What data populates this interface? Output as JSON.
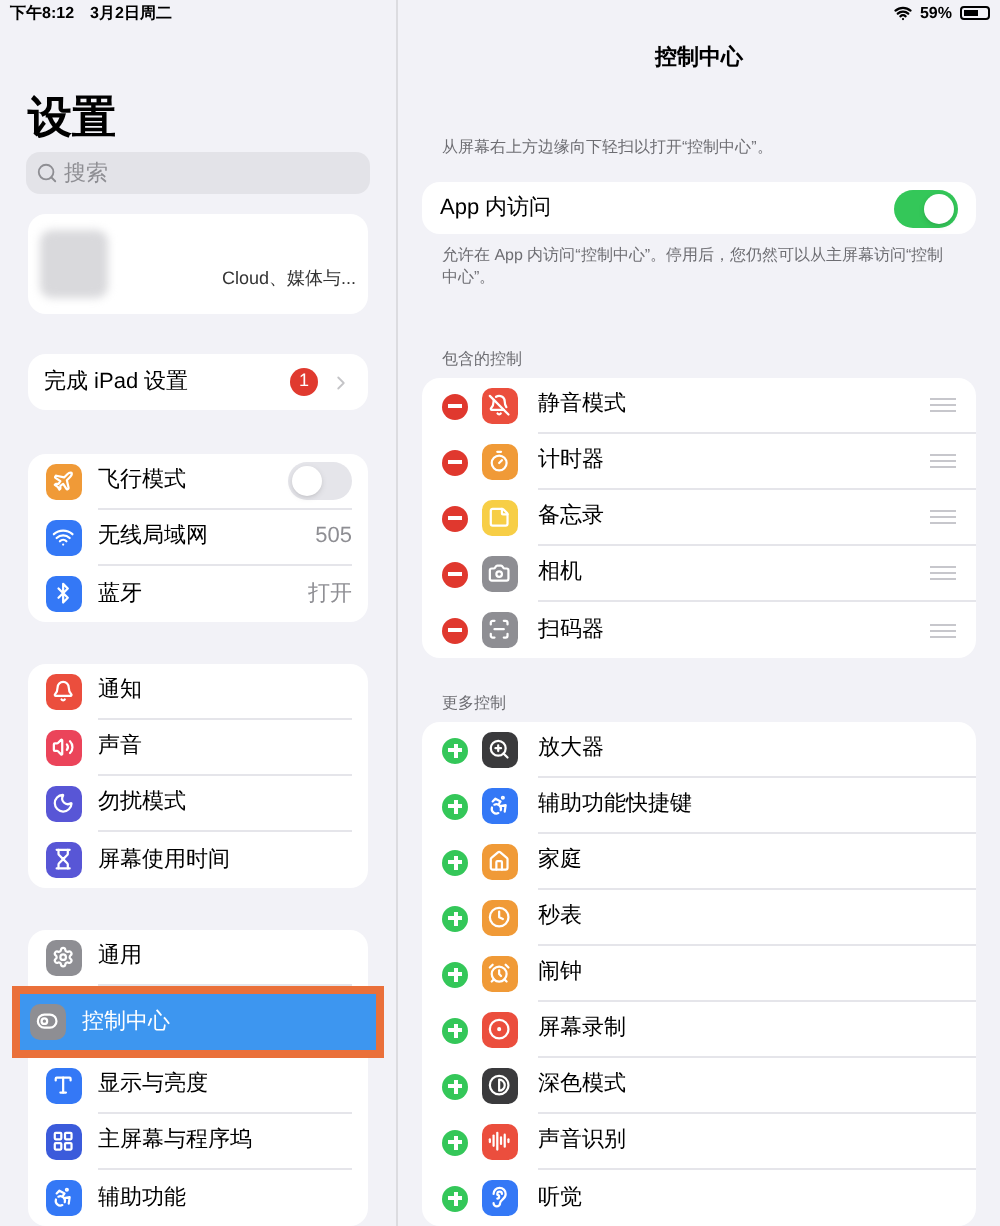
{
  "status_bar": {
    "time": "下午8:12",
    "date": "3月2日周二",
    "battery": "59%"
  },
  "sidebar": {
    "title": "设置",
    "search": {
      "placeholder": "搜索"
    },
    "profile": {
      "subtitle": "Cloud、媒体与..."
    },
    "setup": {
      "label": "完成 iPad 设置",
      "badge": "1"
    },
    "groups": [
      [
        {
          "label": "飞行模式",
          "kind": "toggle",
          "on": false,
          "selected": false
        },
        {
          "label": "无线局域网",
          "kind": "value",
          "value": "505",
          "selected": false
        },
        {
          "label": "蓝牙",
          "kind": "value",
          "value": "打开",
          "selected": false
        }
      ],
      [
        {
          "label": "通知",
          "kind": "plain",
          "selected": false
        },
        {
          "label": "声音",
          "kind": "plain",
          "selected": false
        },
        {
          "label": "勿扰模式",
          "kind": "plain",
          "selected": false
        },
        {
          "label": "屏幕使用时间",
          "kind": "plain",
          "selected": false
        }
      ],
      [
        {
          "label": "通用",
          "kind": "plain",
          "selected": false
        },
        {
          "label": "控制中心",
          "kind": "plain",
          "selected": true
        },
        {
          "label": "显示与亮度",
          "kind": "plain",
          "selected": false
        },
        {
          "label": "主屏幕与程序坞",
          "kind": "plain",
          "selected": false
        },
        {
          "label": "辅助功能",
          "kind": "plain",
          "selected": false
        }
      ]
    ]
  },
  "detail": {
    "title": "控制中心",
    "description": "从屏幕右上方边缘向下轻扫以打开“控制中心”。",
    "app_access": {
      "label": "App 内访问",
      "on": true
    },
    "app_access_note": "允许在 App 内访问“控制中心”。停用后，您仍然可以从主屏幕访问“控制中心”。",
    "included": {
      "header": "包含的控制",
      "items": [
        "静音模式",
        "计时器",
        "备忘录",
        "相机",
        "扫码器"
      ]
    },
    "more": {
      "header": "更多控制",
      "items": [
        "放大器",
        "辅助功能快捷键",
        "家庭",
        "秒表",
        "闹钟",
        "屏幕录制",
        "深色模式",
        "声音识别",
        "听觉"
      ]
    }
  }
}
